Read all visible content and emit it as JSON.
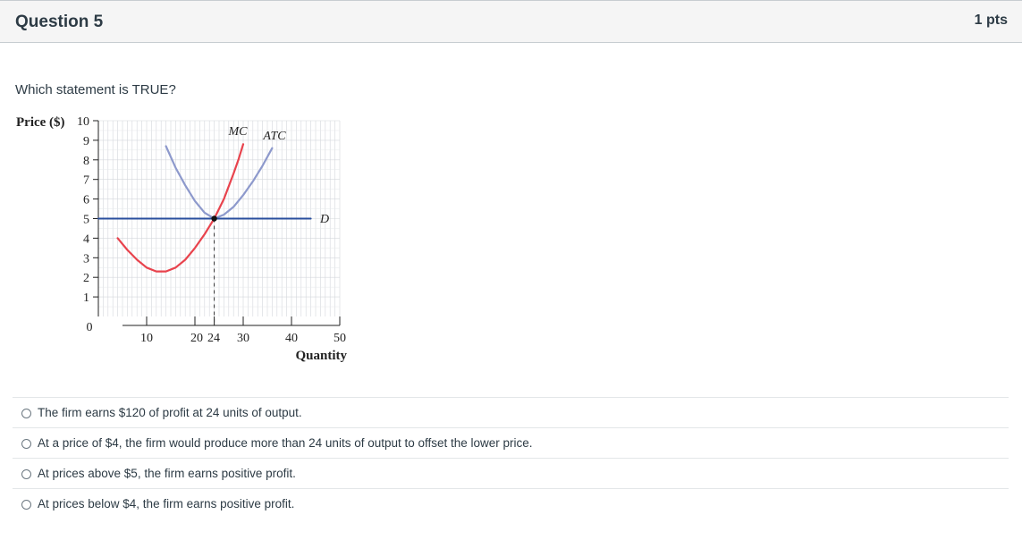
{
  "question": {
    "title": "Question 5",
    "points": "1 pts",
    "prompt": "Which statement is TRUE?"
  },
  "chart_data": {
    "type": "line",
    "ylabel": "Price ($)",
    "xlabel": "Quantity",
    "xlim": [
      0,
      50
    ],
    "ylim": [
      0,
      10
    ],
    "x_ticks": [
      "10",
      "20",
      "24",
      "30",
      "40",
      "50"
    ],
    "y_ticks": [
      "0",
      "1",
      "2",
      "3",
      "4",
      "5",
      "6",
      "7",
      "8",
      "9",
      "10"
    ],
    "grid": true,
    "series": [
      {
        "name": "MC",
        "color": "#e8434d",
        "points": [
          [
            4,
            4.0
          ],
          [
            6,
            3.4
          ],
          [
            8,
            2.9
          ],
          [
            10,
            2.5
          ],
          [
            12,
            2.3
          ],
          [
            14,
            2.3
          ],
          [
            16,
            2.5
          ],
          [
            18,
            2.9
          ],
          [
            20,
            3.5
          ],
          [
            22,
            4.2
          ],
          [
            24,
            5.0
          ],
          [
            26,
            6.0
          ],
          [
            28,
            7.3
          ],
          [
            29,
            8.0
          ],
          [
            30,
            8.8
          ]
        ]
      },
      {
        "name": "ATC",
        "color": "#8d99cc",
        "points": [
          [
            14,
            8.7
          ],
          [
            16,
            7.6
          ],
          [
            18,
            6.7
          ],
          [
            20,
            5.9
          ],
          [
            22,
            5.3
          ],
          [
            24,
            5.0
          ],
          [
            26,
            5.2
          ],
          [
            28,
            5.6
          ],
          [
            30,
            6.2
          ],
          [
            32,
            6.9
          ],
          [
            34,
            7.7
          ],
          [
            36,
            8.6
          ]
        ]
      },
      {
        "name": "D",
        "color": "#2a4f9e",
        "points": [
          [
            0,
            5
          ],
          [
            44,
            5
          ]
        ]
      }
    ],
    "markers": [
      {
        "x": 24,
        "y": 5
      }
    ],
    "guide_lines": [
      {
        "x": 24,
        "from_y": 0,
        "to_y": 5
      }
    ]
  },
  "answers": [
    "The firm earns $120 of profit at 24 units of output.",
    "At a price of $4, the firm would produce more than 24 units of output to offset the lower price.",
    "At prices above $5, the firm earns positive profit.",
    "At prices below $4, the firm earns positive profit."
  ]
}
